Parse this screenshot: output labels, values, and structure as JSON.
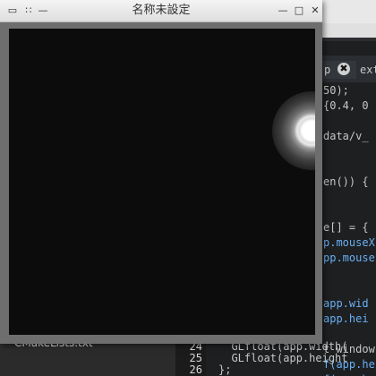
{
  "window": {
    "title": "名称未設定",
    "menu_icon": "window-menu-icon",
    "grip_icon": "grip-dots-icon",
    "minimize_icon": "minimize-icon",
    "maximize_icon": "maximize-icon",
    "close_icon": "close-icon",
    "glyphs": {
      "menu": "▭",
      "grip": "∷",
      "minimize": "—",
      "maximize": "□",
      "close": "✕"
    }
  },
  "canvas": {
    "background": "#0c0c0c",
    "light": "#ffffff"
  },
  "editor": {
    "tabs": [
      {
        "label": "p",
        "active": true
      },
      {
        "label": "ext",
        "active": false
      }
    ],
    "tab_close_glyph": "✖",
    "code_fragments": [
      "50);",
      "{0.4, 0",
      "",
      "data/v_",
      "",
      "",
      "en()) {",
      "",
      "",
      "e[] = {",
      "p.mouseX",
      "pp.mouse",
      "",
      "",
      "app.wid",
      "app.hei",
      "",
      "t window",
      "f(app.he",
      "f(app.he"
    ],
    "line_numbers": [
      "24",
      "25",
      "26"
    ],
    "bottom_code": [
      "  GLfloat(app.width(",
      "  GLfloat(app.height",
      "};"
    ],
    "sidebar_file": "CMakeLists.txt"
  }
}
